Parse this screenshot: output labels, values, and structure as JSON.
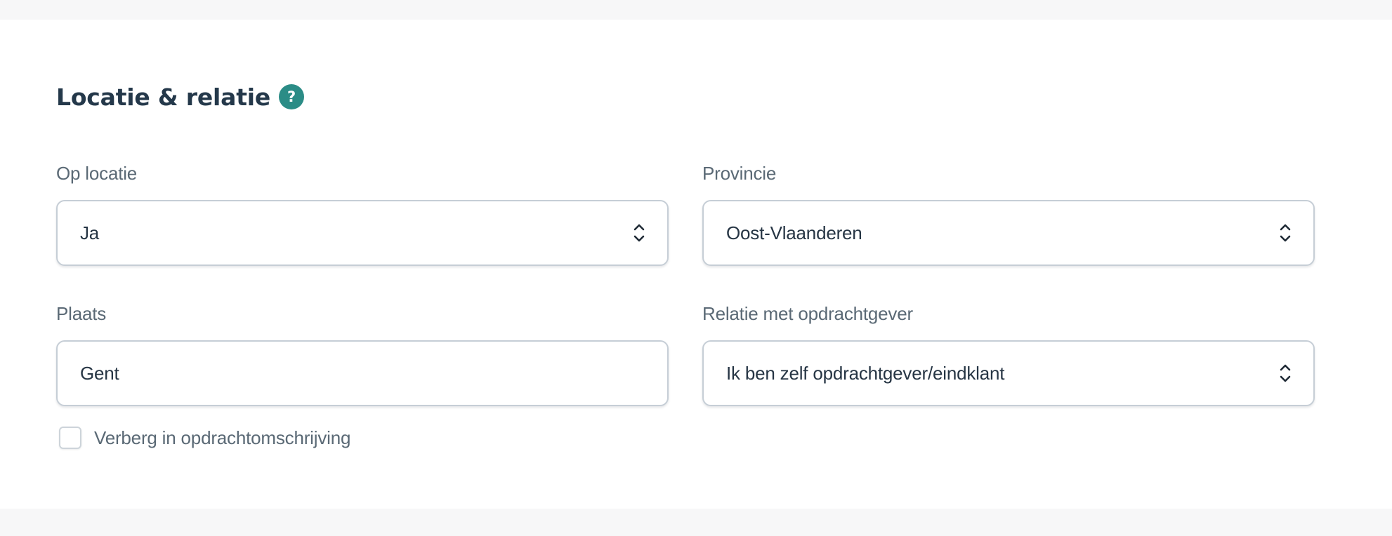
{
  "section": {
    "title": "Locatie & relatie",
    "help_icon_glyph": "?",
    "help_icon": "help-circle-icon",
    "accent_color": "#2b8c86"
  },
  "fields": {
    "op_locatie": {
      "label": "Op locatie",
      "value": "Ja",
      "icon": "chevron-up-down-icon"
    },
    "provincie": {
      "label": "Provincie",
      "value": "Oost-Vlaanderen",
      "icon": "chevron-up-down-icon"
    },
    "plaats": {
      "label": "Plaats",
      "value": "Gent"
    },
    "relatie": {
      "label": "Relatie met opdrachtgever",
      "value": "Ik ben zelf opdrachtgever/eindklant",
      "icon": "chevron-up-down-icon"
    }
  },
  "checkbox": {
    "label": "Verberg in opdrachtomschrijving",
    "checked": false
  }
}
